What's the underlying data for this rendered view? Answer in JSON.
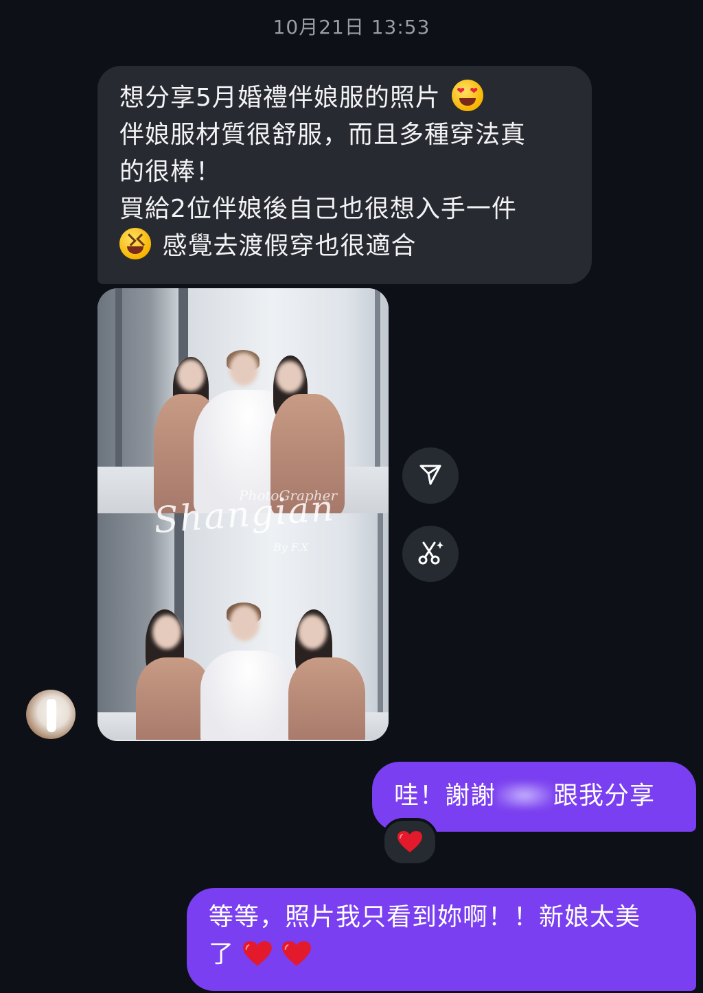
{
  "header": {
    "timestamp": "10月21日 13:53"
  },
  "incoming_message": {
    "lines": [
      "想分享5月婚禮伴娘服的照片",
      "伴娘服材質很舒服，而且多種穿法真",
      "的很棒！",
      "買給2位伴娘後自己也很想入手一件",
      "感覺去渡假穿也很適合"
    ],
    "emojis": [
      "heart-eyes-emoji",
      "grinning-squint-emoji"
    ]
  },
  "photo": {
    "watermark_script": "Shangian",
    "watermark_top": "PhotoGrapher",
    "watermark_by": "By F.X"
  },
  "side_actions": {
    "share_icon": "send-icon",
    "edit_icon": "scissors-sparkle-icon"
  },
  "outgoing_messages": [
    {
      "text_before": "哇！謝謝",
      "text_after": "跟我分享"
    },
    {
      "line1": "等等，照片我只看到妳啊！！新娘太美",
      "line2": "了"
    }
  ],
  "reaction": {
    "emoji": "red-heart-emoji"
  },
  "colors": {
    "background": "#0d1017",
    "incoming_bubble": "#272a31",
    "outgoing_bubble": "#7a3ff0",
    "timestamp_text": "#9a9da6"
  }
}
